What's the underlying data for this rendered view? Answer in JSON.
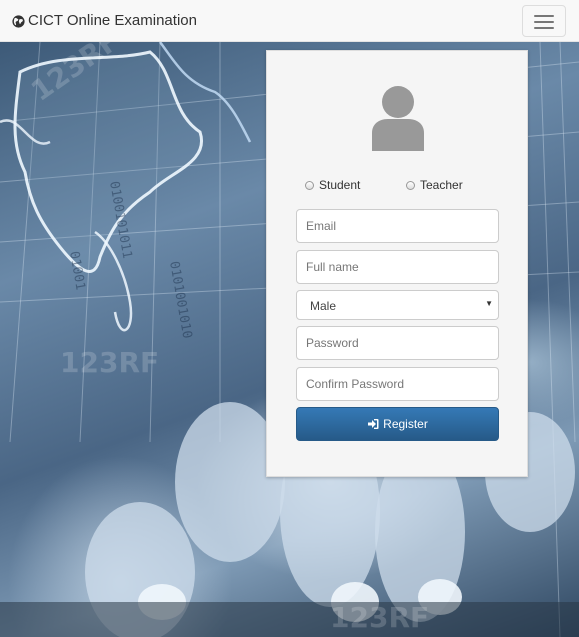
{
  "navbar": {
    "brand": "CICT Online Examination",
    "brand_icon": "globe-icon",
    "toggle_icon": "hamburger-icon"
  },
  "form": {
    "avatar_icon": "user-silhouette-icon",
    "roles": [
      {
        "label": "Student",
        "selected": false
      },
      {
        "label": "Teacher",
        "selected": false
      }
    ],
    "email_placeholder": "Email",
    "fullname_placeholder": "Full name",
    "gender_value": "Male",
    "password_placeholder": "Password",
    "confirm_placeholder": "Confirm Password",
    "register_label": "Register",
    "register_icon": "sign-in-icon",
    "button_color": "#2d6ca2"
  }
}
